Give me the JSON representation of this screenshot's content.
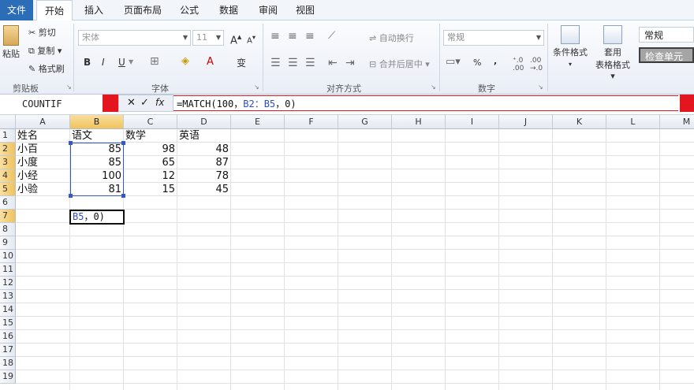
{
  "tabs": [
    "文件",
    "开始",
    "插入",
    "页面布局",
    "公式",
    "数据",
    "审阅",
    "视图"
  ],
  "ribbon": {
    "clipboard": {
      "paste": "粘贴",
      "cut": "剪切",
      "copy": "复制",
      "format_painter": "格式刷",
      "label": "剪贴板"
    },
    "font": {
      "name": "宋体",
      "size": "11",
      "bold": "B",
      "italic": "I",
      "underline": "U",
      "grow": "A",
      "shrink": "A",
      "color_a": "A",
      "wen": "变",
      "label": "字体"
    },
    "align": {
      "wrap": "自动换行",
      "merge": "合并后居中",
      "label": "对齐方式"
    },
    "number": {
      "format": "常规",
      "percent": "%",
      "comma": ",",
      "label": "数字"
    },
    "styles": {
      "conditional": "条件格式",
      "table": "套用",
      "table2": "表格格式",
      "normal": "常规",
      "check": "检查单元",
      "check_color": "#a5a5a5"
    }
  },
  "formula_bar": {
    "name_box": "COUNTIF",
    "cancel": "✕",
    "enter": "✓",
    "fx": "fx",
    "formula_prefix": "=MATCH(100，",
    "formula_ref": "B2：B5",
    "formula_suffix": "，0)"
  },
  "columns": [
    "A",
    "B",
    "C",
    "D",
    "E",
    "F",
    "G",
    "H",
    "I",
    "J",
    "K",
    "L",
    "M"
  ],
  "rows": [
    "1",
    "2",
    "3",
    "4",
    "5",
    "6",
    "7",
    "8",
    "9",
    "10",
    "11",
    "12",
    "13",
    "14",
    "15",
    "16",
    "17",
    "18",
    "19"
  ],
  "headers": [
    "姓名",
    "语文",
    "数学",
    "英语"
  ],
  "table": [
    [
      "小百",
      "85",
      "98",
      "48"
    ],
    [
      "小度",
      "85",
      "65",
      "87"
    ],
    [
      "小经",
      "100",
      "12",
      "78"
    ],
    [
      "小验",
      "81",
      "15",
      "45"
    ]
  ],
  "edit_cell": {
    "ref": "B5",
    "rest": "，0)"
  },
  "colors": {
    "accent": "#2c6db8",
    "red": "#e3161f",
    "range": "#3459c6",
    "selected_header": "#f0c35c"
  }
}
